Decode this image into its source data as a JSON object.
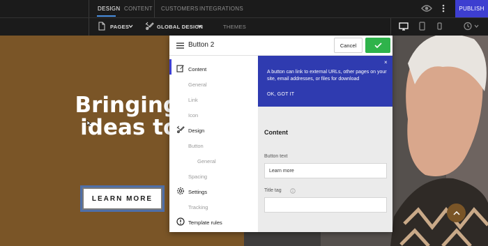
{
  "topnav": {
    "tabs": [
      "DESIGN",
      "CONTENT"
    ],
    "links": [
      "CUSTOMERS",
      "INTEGRATIONS"
    ],
    "publish_label": "PUBLISH",
    "icons": [
      "eye-icon",
      "more-vertical-icon"
    ]
  },
  "toolbar": {
    "pages_label": "PAGES",
    "global_design_label": "GLOBAL DESIGN",
    "themes_label": "THEMES",
    "icons": [
      "desktop-icon",
      "tablet-icon",
      "mobile-icon",
      "history-icon"
    ]
  },
  "hero": {
    "title_line1": "Bringing yo",
    "title_line2": "ideas to lif",
    "button_label": "LEARN MORE"
  },
  "panel": {
    "title": "Button 2",
    "cancel_label": "Cancel",
    "nav": [
      {
        "label": "Content",
        "type": "main",
        "icon": "edit-icon"
      },
      {
        "label": "General",
        "type": "sub"
      },
      {
        "label": "Link",
        "type": "sub"
      },
      {
        "label": "Icon",
        "type": "sub"
      },
      {
        "label": "Design",
        "type": "main",
        "icon": "paint-brush-icon"
      },
      {
        "label": "Button",
        "type": "sub"
      },
      {
        "label": "General",
        "type": "sub2"
      },
      {
        "label": "Spacing",
        "type": "sub"
      },
      {
        "label": "Settings",
        "type": "main",
        "icon": "gear-icon"
      },
      {
        "label": "Tracking",
        "type": "sub"
      },
      {
        "label": "Template rules",
        "type": "main",
        "icon": "alert-circle-icon"
      }
    ],
    "tip": {
      "text": "A button can link to external URLs, other pages on your site, email addresses, or files for download",
      "ok_label": "OK, GOT IT",
      "close": "×"
    },
    "section_title": "Content",
    "button_text_label": "Button text",
    "button_text_value": "Learn more",
    "title_tag_label": "Title tag",
    "title_tag_value": ""
  },
  "colors": {
    "accent": "#3d3ed0",
    "confirm": "#2fb34b",
    "hero_brown": "#7a5527",
    "tip_blue": "#2f3bb0"
  }
}
